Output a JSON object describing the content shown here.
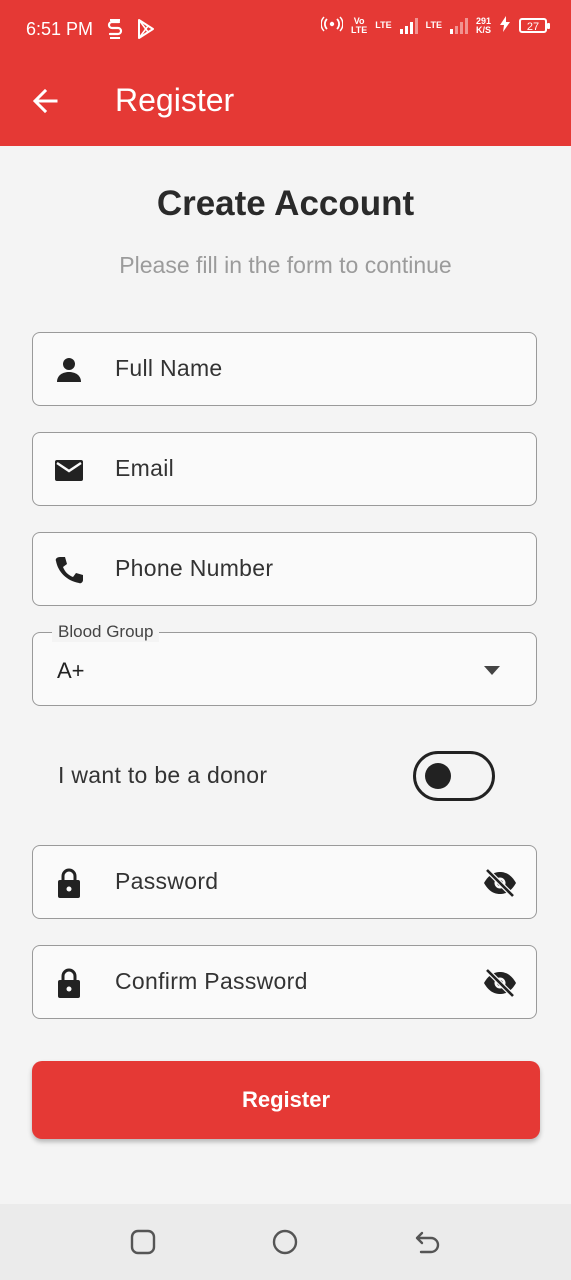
{
  "status_bar": {
    "time": "6:51 PM",
    "volte_top": "Vo",
    "volte_bottom": "LTE",
    "lte1_label": "LTE",
    "lte2_label": "LTE",
    "speed_value": "291",
    "speed_unit": "K/S",
    "battery": "27"
  },
  "app_bar": {
    "title": "Register"
  },
  "heading": "Create Account",
  "subheading": "Please fill in the form to continue",
  "fields": {
    "full_name": {
      "label": "Full Name",
      "icon": "person-icon"
    },
    "email": {
      "label": "Email",
      "icon": "mail-icon"
    },
    "phone": {
      "label": "Phone Number",
      "icon": "phone-icon"
    },
    "blood_group": {
      "legend": "Blood Group",
      "value": "A+"
    },
    "password": {
      "label": "Password",
      "icon": "lock-icon"
    },
    "confirm_password": {
      "label": "Confirm Password",
      "icon": "lock-icon"
    }
  },
  "donor": {
    "label": "I want to be a donor",
    "enabled": false
  },
  "register_button": "Register",
  "colors": {
    "primary": "#e53935",
    "background": "#f4f4f4"
  }
}
